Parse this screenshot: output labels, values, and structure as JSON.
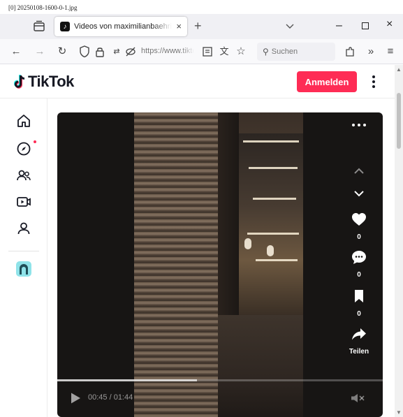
{
  "file_label": "[0] 20250108-1600-0-1.jpg",
  "browser": {
    "tab_title": "Videos von maximilianbaehring",
    "tab_close": "×",
    "new_tab": "+",
    "url": "https://www.tiktok.com",
    "search_placeholder": "Suchen",
    "window_min": "–",
    "window_close": "×"
  },
  "tiktok": {
    "logo_text": "TikTok",
    "login_label": "Anmelden",
    "sidebar": [
      {
        "name": "home",
        "icon": "home-icon"
      },
      {
        "name": "explore",
        "icon": "compass-icon"
      },
      {
        "name": "following",
        "icon": "users-icon"
      },
      {
        "name": "live",
        "icon": "live-video-icon"
      },
      {
        "name": "profile",
        "icon": "user-icon"
      },
      {
        "name": "avatar",
        "icon": "avatar-icon"
      }
    ],
    "video": {
      "likes": "0",
      "comments": "0",
      "saves": "0",
      "share_label": "Teilen",
      "time": "00:45 / 01:44",
      "progress": 0.43
    }
  },
  "colors": {
    "accent": "#fe2c55",
    "tiktok_cyan": "#25f4ee"
  }
}
